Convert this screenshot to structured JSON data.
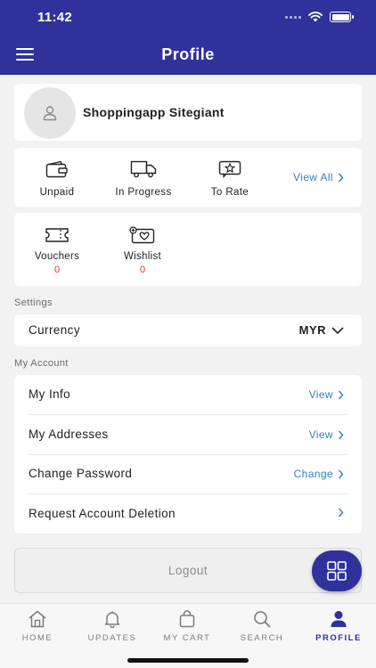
{
  "status": {
    "time": "11:42"
  },
  "header": {
    "title": "Profile"
  },
  "profile": {
    "name": "Shoppingapp Sitegiant"
  },
  "orders": {
    "items": [
      {
        "label": "Unpaid",
        "icon": "wallet-icon"
      },
      {
        "label": "In Progress",
        "icon": "delivery-truck-icon"
      },
      {
        "label": "To Rate",
        "icon": "star-rating-icon"
      }
    ],
    "view_all": "View All"
  },
  "perks": {
    "items": [
      {
        "label": "Vouchers",
        "count": "0",
        "icon": "voucher-icon"
      },
      {
        "label": "Wishlist",
        "count": "0",
        "icon": "wishlist-heart-icon"
      }
    ]
  },
  "settings": {
    "title": "Settings",
    "currency_label": "Currency",
    "currency_value": "MYR"
  },
  "account": {
    "title": "My Account",
    "rows": [
      {
        "label": "My Info",
        "action": "View"
      },
      {
        "label": "My Addresses",
        "action": "View"
      },
      {
        "label": "Change Password",
        "action": "Change"
      },
      {
        "label": "Request Account Deletion",
        "action": ""
      }
    ]
  },
  "logout_label": "Logout",
  "tabs": [
    {
      "label": "HOME",
      "icon": "home-icon"
    },
    {
      "label": "UPDATES",
      "icon": "bell-icon"
    },
    {
      "label": "MY CART",
      "icon": "shopping-bag-icon"
    },
    {
      "label": "SEARCH",
      "icon": "search-icon"
    },
    {
      "label": "PROFILE",
      "icon": "profile-icon",
      "active": true
    }
  ],
  "colors": {
    "primary": "#30319b",
    "link": "#2f7fbf",
    "count": "#e0322a"
  }
}
